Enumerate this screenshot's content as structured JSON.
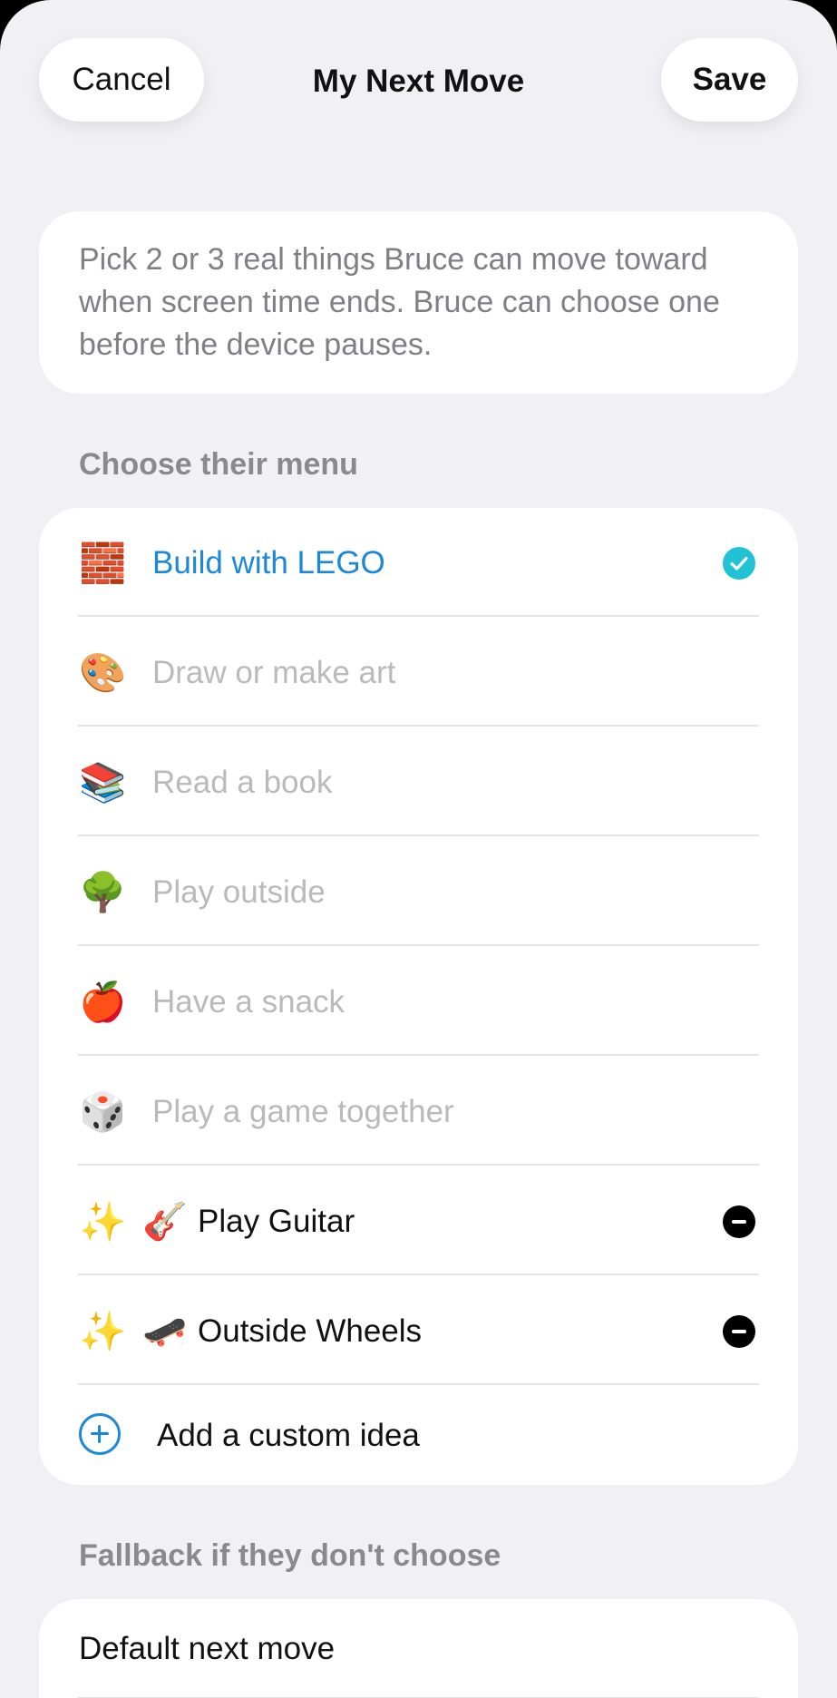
{
  "header": {
    "cancel_label": "Cancel",
    "title": "My Next Move",
    "save_label": "Save"
  },
  "info": {
    "text": "Pick 2 or 3 real things Bruce can move toward when screen time ends. Bruce can choose one before the device pauses."
  },
  "menu": {
    "section_label": "Choose their menu",
    "items": [
      {
        "emoji": "🧱",
        "label": "Build with LEGO",
        "selected": true,
        "icon": "checkmark-circle-icon"
      },
      {
        "emoji": "🎨",
        "label": "Draw or make art",
        "selected": false
      },
      {
        "emoji": "📚",
        "label": "Read a book",
        "selected": false
      },
      {
        "emoji": "🌳",
        "label": "Play outside",
        "selected": false
      },
      {
        "emoji": "🍎",
        "label": "Have a snack",
        "selected": false
      },
      {
        "emoji": "🎲",
        "label": "Play a game together",
        "selected": false
      }
    ],
    "custom_items": [
      {
        "sparkle": "✨",
        "emoji": "🎸",
        "label": "Play Guitar",
        "icon": "minus-circle-icon"
      },
      {
        "sparkle": "✨",
        "emoji": "🛹",
        "label": "Outside Wheels",
        "icon": "minus-circle-icon"
      }
    ],
    "add_label": "Add a custom idea"
  },
  "fallback": {
    "section_label": "Fallback if they don't choose",
    "default_label": "Default next move"
  },
  "colors": {
    "accent": "#1e88d8",
    "check": "#21c1d6",
    "background": "#f1f1f5",
    "muted_text": "#b9b9be"
  }
}
